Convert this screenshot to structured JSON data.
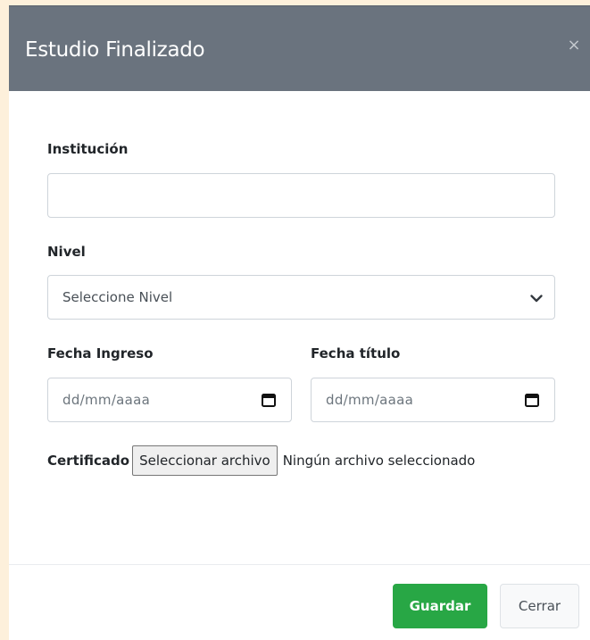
{
  "modal": {
    "title": "Estudio Finalizado",
    "close_symbol": "×"
  },
  "form": {
    "institucion": {
      "label": "Institución",
      "value": "",
      "placeholder": ""
    },
    "nivel": {
      "label": "Nivel",
      "selected": "Seleccione Nivel"
    },
    "fecha_ingreso": {
      "label": "Fecha Ingreso",
      "value": "dd/mm/aaaa"
    },
    "fecha_titulo": {
      "label": "Fecha título",
      "value": "dd/mm/aaaa"
    },
    "certificado": {
      "label": "Certificado",
      "button_label": "Seleccionar archivo",
      "status": "Ningún archivo seleccionado"
    }
  },
  "footer": {
    "save_label": "Guardar",
    "close_label": "Cerrar"
  },
  "icons": {
    "close": "close-icon",
    "select": "chevron-down-icon",
    "date": "calendar-icon"
  },
  "colors": {
    "header": "#6a737e",
    "primary": "#28a745",
    "page_background": "#fdf0db"
  }
}
